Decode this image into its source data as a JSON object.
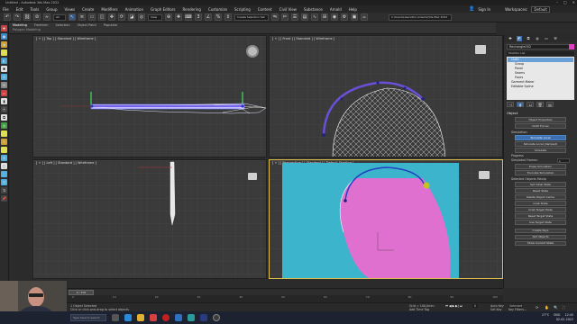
{
  "window": {
    "title": "Untitled - Autodesk 3ds Max 2022",
    "controls": [
      "–",
      "□",
      "✕"
    ]
  },
  "menubar": {
    "items": [
      "File",
      "Edit",
      "Tools",
      "Group",
      "Views",
      "Create",
      "Modifiers",
      "Animation",
      "Graph Editors",
      "Rendering",
      "Customize",
      "Scripting",
      "Content",
      "Civil View",
      "Substance",
      "Arnold",
      "Help"
    ],
    "signin": "Sign In",
    "workspaces_label": "Workspaces:",
    "workspaces_value": "Default"
  },
  "toolbar": {
    "view_dropdown": "View",
    "selection_set": "Create Selection Set",
    "path": "C:\\Users\\Users\\Documents\\3ds Max 2022"
  },
  "ribbon": {
    "tabs": [
      "Modeling",
      "Freeform",
      "Selection",
      "Object Paint",
      "Populate"
    ],
    "active_tab": "Modeling",
    "panel_label": "Polygon Modeling"
  },
  "viewports": {
    "top_left": {
      "label": "[ + ] [ Top ] [ Standard ] [ Wireframe ]"
    },
    "top_right": {
      "label": "[ + ] [ Front ] [ Standard ] [ Wireframe ]"
    },
    "bottom_left": {
      "label": "[ + ] [ Left ] [ Standard ] [ Wireframe ]"
    },
    "bottom_right": {
      "label": "[ + ] [ Perspective ] [ Standard ] [ Default Shading ]"
    }
  },
  "command_panel": {
    "object_name": "Rectangle002",
    "modifier_list_label": "Modifier List",
    "stack": [
      {
        "label": "Cloth",
        "selected": true
      },
      {
        "label": "Group",
        "selected": false
      },
      {
        "label": "Panel",
        "selected": false
      },
      {
        "label": "Seams",
        "selected": false
      },
      {
        "label": "Faces",
        "selected": false
      },
      {
        "label": "Garment Maker",
        "selected": false
      },
      {
        "label": "Editable Spline",
        "selected": false
      }
    ],
    "rollout_title": "Object",
    "buttons_top": [
      "Object Properties",
      "Cloth Forces"
    ],
    "simulation_label": "Simulation",
    "sim_buttons": [
      "Simulate Local",
      "Simulate Local (damped)",
      "Simulate"
    ],
    "progress_label": "Progress",
    "simulated_frames_label": "Simulated Frames:",
    "simulated_frames_value": "1",
    "sim_buttons2": [
      "Erase Simulation",
      "Truncate Simulation"
    ],
    "selected_objects_label": "Selected Objects Manip",
    "manip_buttons": [
      "Set Initial State",
      "Reset State",
      "Delete Object Cache",
      "Grab State",
      "Grab Target State",
      "Reset Target State",
      "Use Target State"
    ],
    "bottom_buttons": [
      "Create Keys",
      "Add Objects",
      "Show Current State"
    ]
  },
  "timeline": {
    "slider_label": "0 / 100",
    "ticks": [
      "0",
      "10",
      "20",
      "30",
      "40",
      "50",
      "60",
      "70",
      "80",
      "90",
      "100"
    ]
  },
  "statusbar": {
    "selected": "1 Object Selected",
    "prompt": "Click or click-and-drag to select objects",
    "grid": "Grid = 100,0mm",
    "add_time_tag": "Add Time Tag",
    "auto_key": "Auto Key",
    "set_key": "Set Key",
    "selected_dd": "Selected",
    "key_filters": "Key Filters...",
    "frame": "0"
  },
  "taskbar": {
    "search_placeholder": "Type here to search",
    "weather": "27°C",
    "time": "12:45",
    "date": "02-02-2022",
    "lang": "ENG"
  },
  "colors": {
    "cloth_pink": "#e070d0",
    "persp_bg": "#3cb4cc",
    "selection_blue": "#6aa0d8",
    "button_blue": "#3c6fae",
    "active_vp_border": "#e0c04a"
  }
}
